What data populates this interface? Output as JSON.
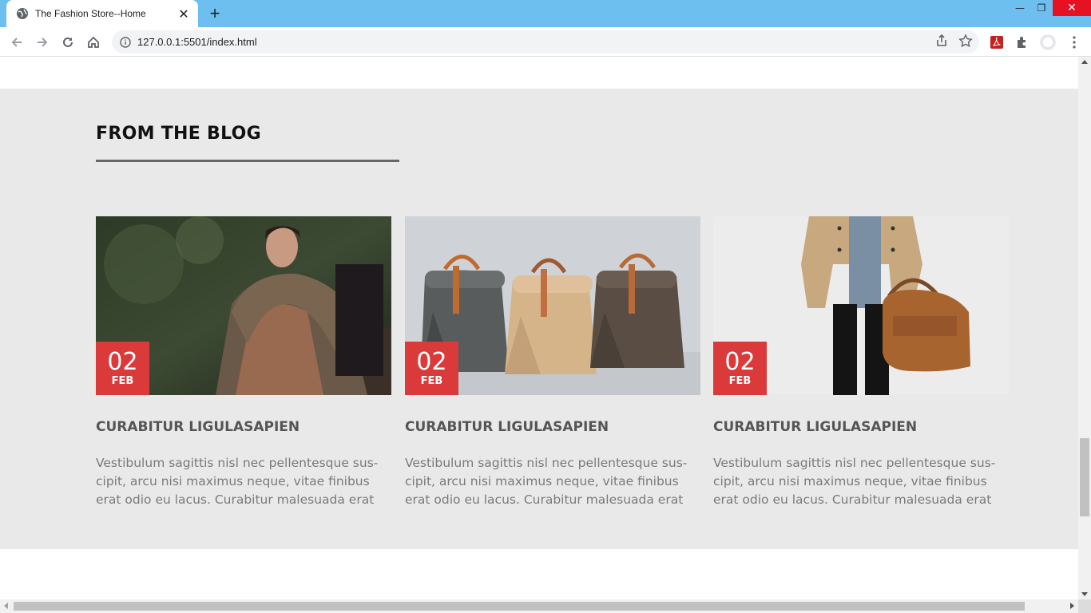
{
  "browser": {
    "tab_title": "The Fashion Store--Home",
    "url": "127.0.0.1:5501/index.html"
  },
  "blog": {
    "heading": "FROM THE BLOG",
    "posts": [
      {
        "day": "02",
        "month": "FEB",
        "title": "CURABITUR LIGULASAPIEN",
        "excerpt": "Vestibulum sagittis nisl nec pellentesque sus-cipit, arcu nisi maximus neque, vitae finibus erat odio eu lacus. Curabitur malesuada erat",
        "image": "man-in-fur-coat"
      },
      {
        "day": "02",
        "month": "FEB",
        "title": "CURABITUR LIGULASAPIEN",
        "excerpt": "Vestibulum sagittis nisl nec pellentesque sus-cipit, arcu nisi maximus neque, vitae finibus erat odio eu lacus. Curabitur malesuada erat",
        "image": "three-roll-top-bags"
      },
      {
        "day": "02",
        "month": "FEB",
        "title": "CURABITUR LIGULASAPIEN",
        "excerpt": "Vestibulum sagittis nisl nec pellentesque sus-cipit, arcu nisi maximus neque, vitae finibus erat odio eu lacus. Curabitur malesuada erat",
        "image": "trench-coat-with-leather-bag"
      }
    ]
  },
  "colors": {
    "accent": "#db3a3a",
    "section_bg": "#e9e9e9",
    "tab_strip": "#6cbfee"
  }
}
